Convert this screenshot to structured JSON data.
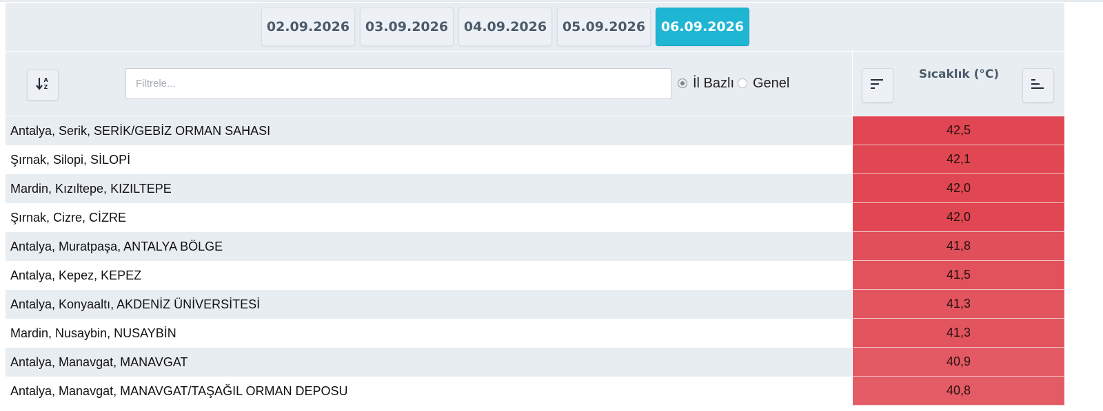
{
  "dates": [
    {
      "label": "02.09.2026",
      "active": false
    },
    {
      "label": "03.09.2026",
      "active": false
    },
    {
      "label": "04.09.2026",
      "active": false
    },
    {
      "label": "05.09.2026",
      "active": false
    },
    {
      "label": "06.09.2026",
      "active": true
    }
  ],
  "filter": {
    "placeholder": "Filtrele...",
    "value": ""
  },
  "radios": [
    {
      "label": "İl Bazlı",
      "checked": true
    },
    {
      "label": "Genel",
      "checked": false
    }
  ],
  "table": {
    "value_column_title": "Sıcaklık (°C)",
    "rows": [
      {
        "name": "Antalya, Serik, SERİK/GEBİZ ORMAN SAHASI",
        "value": "42,5",
        "color": "#e04752"
      },
      {
        "name": "Şırnak, Silopi, SİLOPİ",
        "value": "42,1",
        "color": "#e04752"
      },
      {
        "name": "Mardin, Kızıltepe, KIZILTEPE",
        "value": "42,0",
        "color": "#e04752"
      },
      {
        "name": "Şırnak, Cizre, CİZRE",
        "value": "42,0",
        "color": "#e04752"
      },
      {
        "name": "Antalya, Muratpaşa, ANTALYA BÖLGE",
        "value": "41,8",
        "color": "#e1505a"
      },
      {
        "name": "Antalya, Kepez, KEPEZ",
        "value": "41,5",
        "color": "#e1525c"
      },
      {
        "name": "Antalya, Konyaaltı, AKDENİZ ÜNİVERSİTESİ",
        "value": "41,3",
        "color": "#e2555f"
      },
      {
        "name": "Mardin, Nusaybin, NUSAYBİN",
        "value": "41,3",
        "color": "#e2555f"
      },
      {
        "name": "Antalya, Manavgat, MANAVGAT",
        "value": "40,9",
        "color": "#e35a64"
      },
      {
        "name": "Antalya, Manavgat, MANAVGAT/TAŞAĞIL ORMAN DEPOSU",
        "value": "40,8",
        "color": "#e35b65"
      }
    ]
  },
  "icons": {
    "sort_alpha": "sort-alpha-icon",
    "sort_desc": "sort-descending-icon",
    "sort_asc": "sort-ascending-icon"
  }
}
